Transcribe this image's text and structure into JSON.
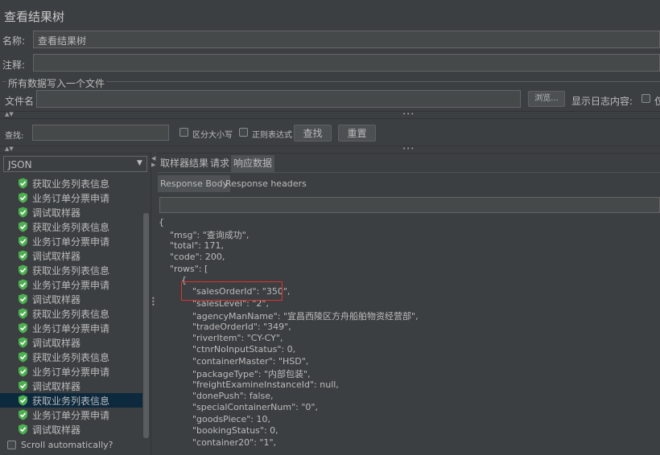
{
  "window": {
    "title": "查看结果树"
  },
  "form": {
    "name_label": "名称:",
    "name_value": "查看结果树",
    "comment_label": "注释:",
    "comment_value": "",
    "group_title": "所有数据写入一个文件",
    "file_label": "文件名",
    "file_value": "",
    "browse_label": "浏览...",
    "log_label": "显示日志内容:",
    "log_suffix": "仅"
  },
  "search": {
    "label": "查找:",
    "value": "",
    "case_label": "区分大小写",
    "regex_label": "正则表达式",
    "find_button": "查找",
    "reset_button": "重置"
  },
  "renderer": {
    "selected": "JSON"
  },
  "tree": {
    "items": [
      "获取业务列表信息",
      "业务订单分票申请",
      "调试取样器",
      "获取业务列表信息",
      "业务订单分票申请",
      "调试取样器",
      "获取业务列表信息",
      "业务订单分票申请",
      "调试取样器",
      "获取业务列表信息",
      "业务订单分票申请",
      "调试取样器",
      "获取业务列表信息",
      "业务订单分票申请",
      "调试取样器",
      "获取业务列表信息",
      "业务订单分票申请",
      "调试取样器"
    ],
    "selected_index": 15,
    "status_color": "#4caf50",
    "scroll_label": "Scroll automatically?"
  },
  "tabs": {
    "main": [
      "取样器结果",
      "请求",
      "响应数据"
    ],
    "main_active": 2,
    "sub": [
      "Response Body",
      "Response headers"
    ],
    "sub_active": 0
  },
  "response": {
    "lines": [
      "{",
      "    \"msg\": \"查询成功\",",
      "    \"total\": 171,",
      "    \"code\": 200,",
      "    \"rows\": [",
      "        {",
      "            \"salesOrderId\": \"350\",",
      "            \"salesLevel\": \"2\",",
      "            \"agencyManName\": \"宜昌西陵区方舟船舶物资经营部\",",
      "            \"tradeOrderId\": \"349\",",
      "            \"riverItem\": \"CY-CY\",",
      "            \"ctnrNoInputStatus\": 0,",
      "            \"containerMaster\": \"HSD\",",
      "            \"packageType\": \"内部包装\",",
      "            \"freightExamineInstanceId\": null,",
      "            \"donePush\": false,",
      "            \"specialContainerNum\": \"0\",",
      "            \"goodsPiece\": 10,",
      "            \"bookingStatus\": 0,",
      "            \"container20\": \"1\","
    ],
    "highlight_line": 6,
    "highlight_color": "#e03030"
  }
}
